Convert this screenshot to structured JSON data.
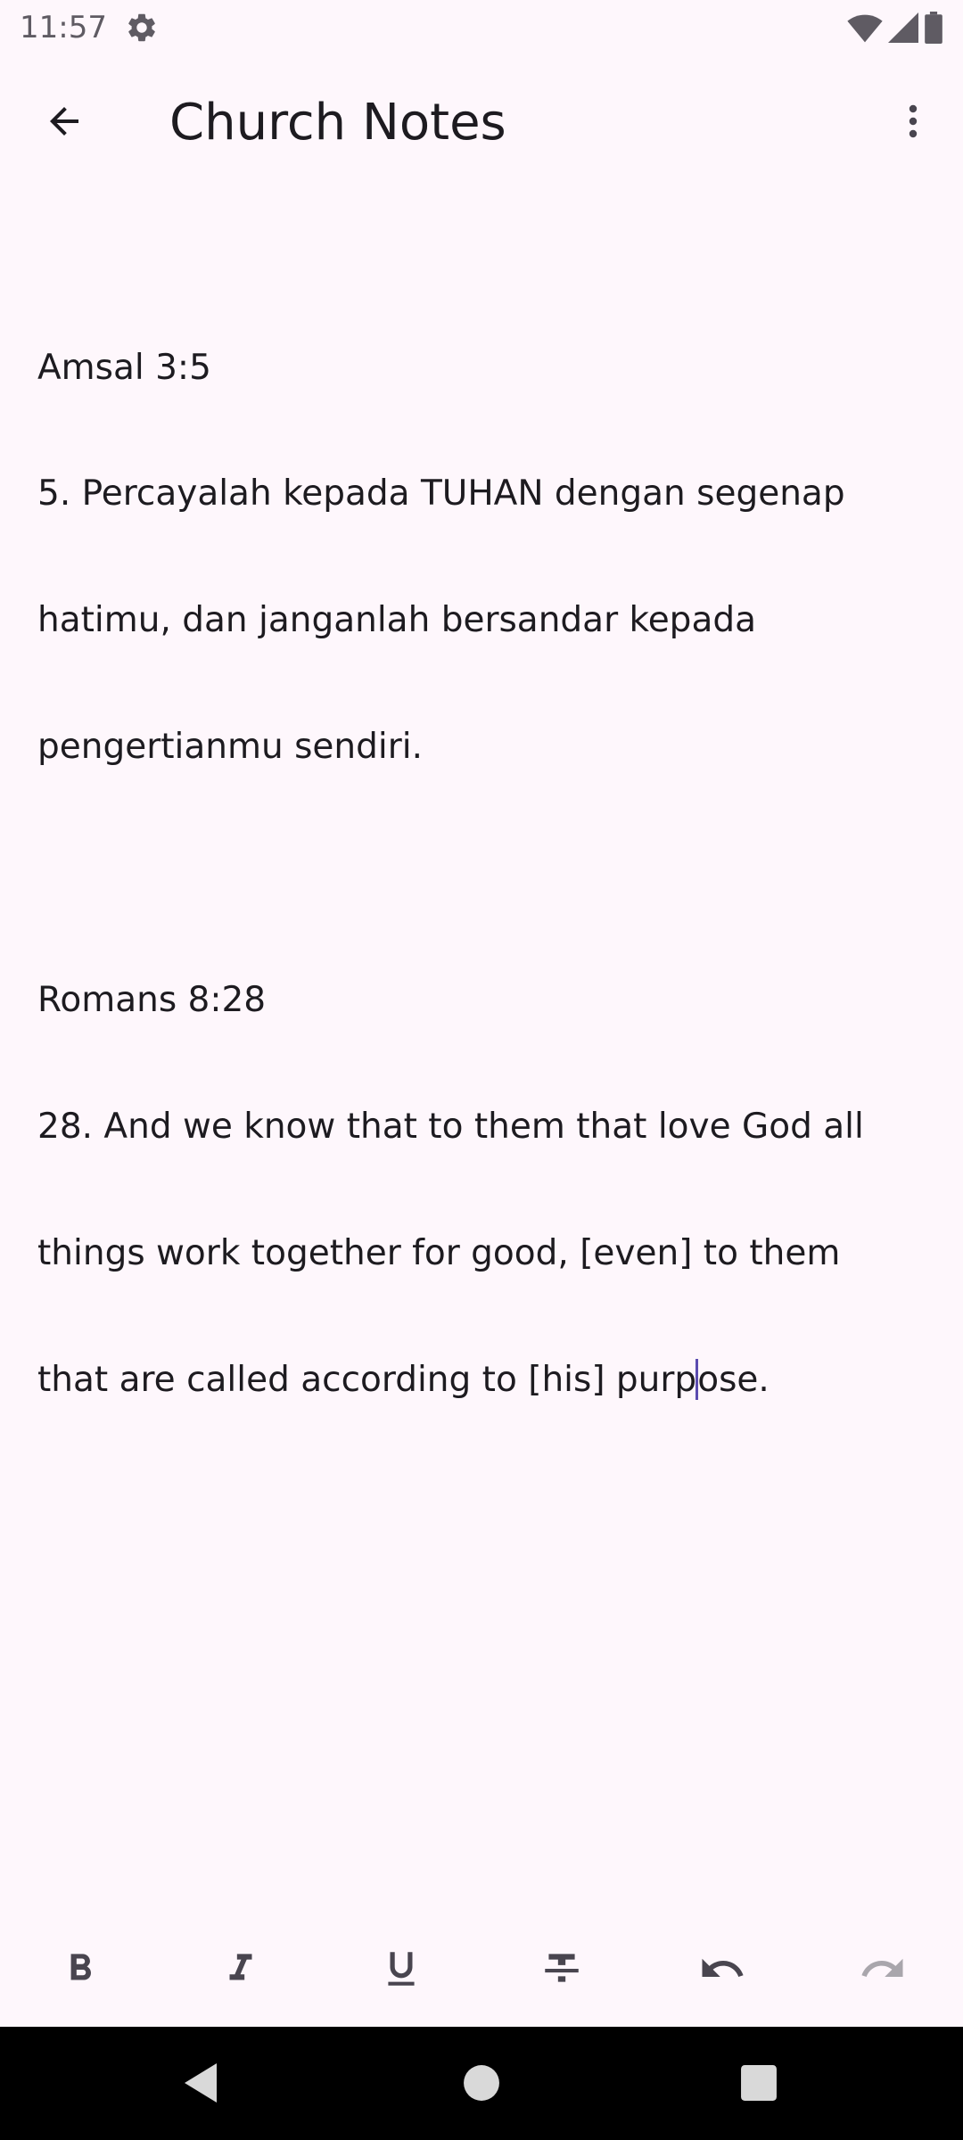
{
  "status_bar": {
    "time": "11:57",
    "icons": [
      "settings-gear-icon",
      "wifi-icon",
      "cellular-signal-icon",
      "battery-icon"
    ]
  },
  "app_bar": {
    "title": "Church Notes",
    "back_icon": "arrow-back-icon",
    "menu_icon": "more-vert-icon"
  },
  "editor": {
    "lines": [
      "Amsal 3:5",
      "5. Percayalah kepada TUHAN dengan segenap",
      "hatimu, dan janganlah bersandar kepada",
      "pengertianmu sendiri.",
      "",
      "Romans 8:28",
      "28. And we know that to them that love God all",
      "things work together for good, [even] to them"
    ],
    "last_line_before_cursor": "that are called according to [his] purp",
    "last_line_after_cursor": "ose."
  },
  "format_toolbar": {
    "buttons": [
      {
        "name": "bold",
        "icon": "format-bold-icon",
        "enabled": true
      },
      {
        "name": "italic",
        "icon": "format-italic-icon",
        "enabled": true
      },
      {
        "name": "underline",
        "icon": "format-underline-icon",
        "enabled": true
      },
      {
        "name": "strikethrough",
        "icon": "format-strikethrough-icon",
        "enabled": true
      },
      {
        "name": "undo",
        "icon": "undo-icon",
        "enabled": true
      },
      {
        "name": "redo",
        "icon": "redo-icon",
        "enabled": false
      }
    ]
  },
  "nav_bar": {
    "icons": [
      "nav-back-icon",
      "nav-home-icon",
      "nav-recents-icon"
    ]
  },
  "colors": {
    "background": "#fef7fc",
    "text": "#1d1b20",
    "cursor": "#5b4bb0",
    "icon": "#49454f",
    "disabled_icon": "#a9a6ac",
    "nav_bar": "#000000"
  }
}
